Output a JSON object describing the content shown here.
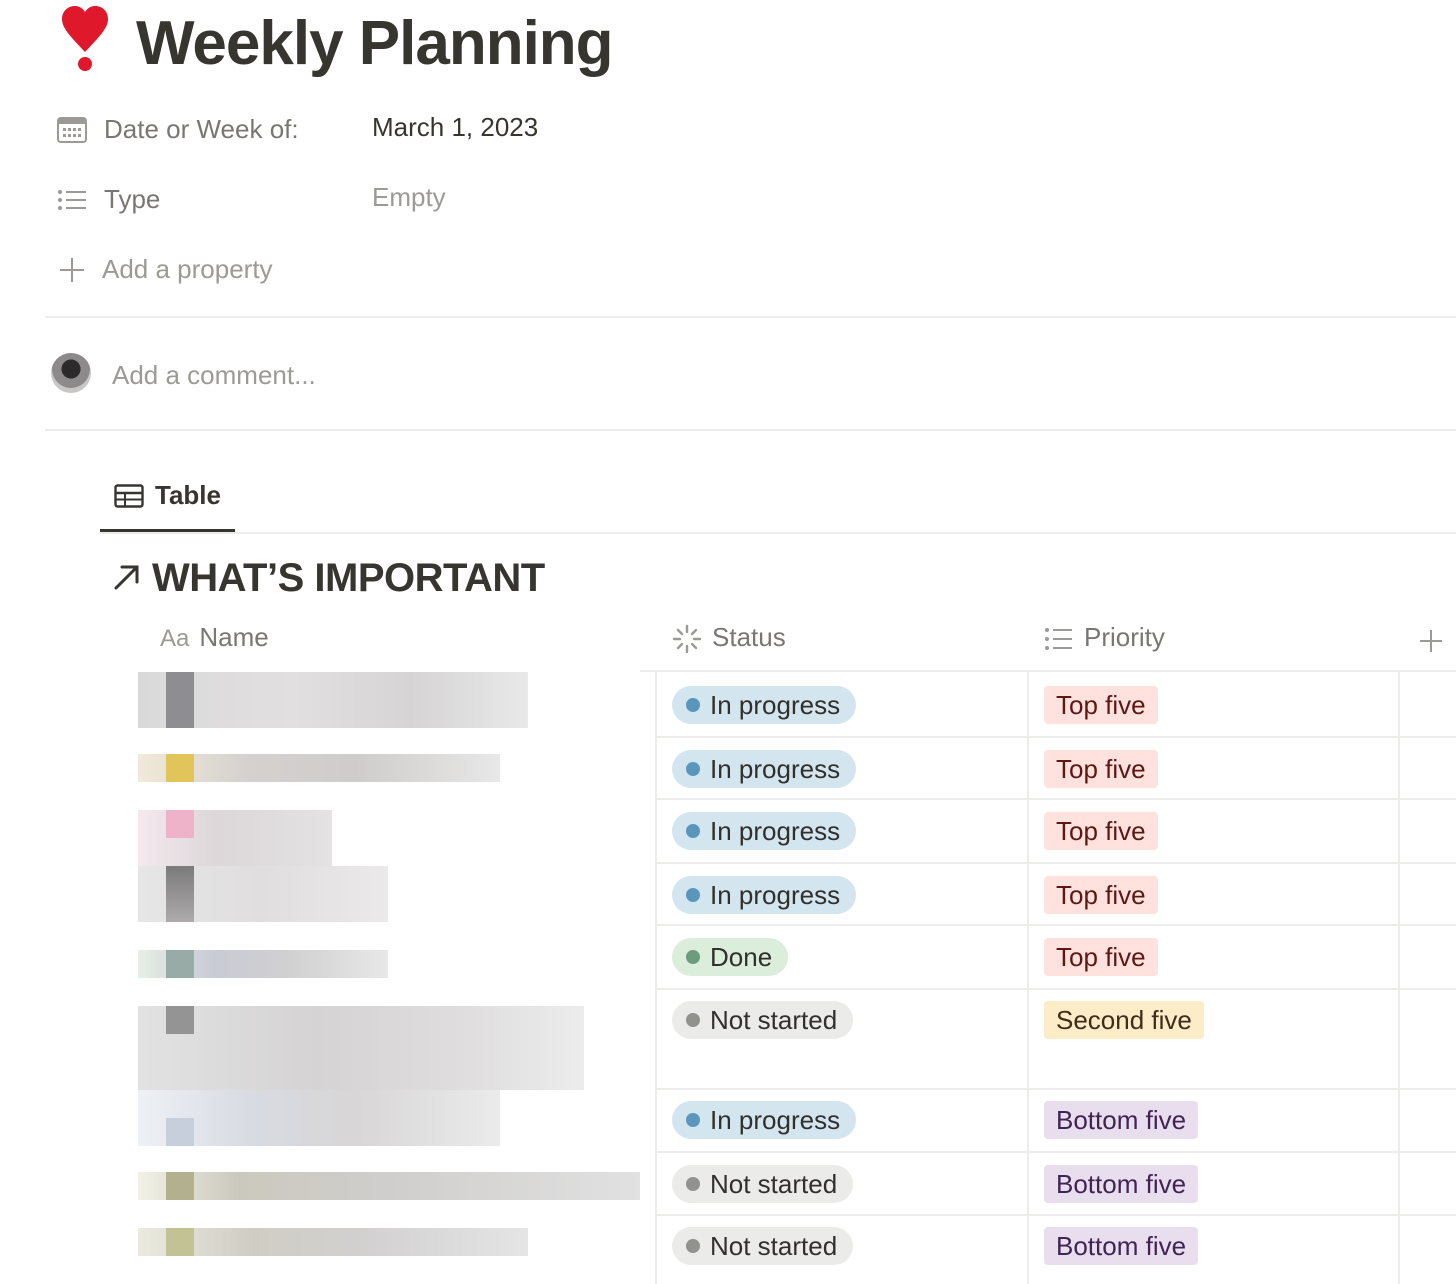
{
  "page": {
    "title_icon": "exclamation-icon",
    "title": "Weekly Planning"
  },
  "properties": [
    {
      "icon": "calendar-icon",
      "label": "Date or Week of:",
      "value": "March 1, 2023",
      "empty": false
    },
    {
      "icon": "list-icon",
      "label": "Type",
      "value": "Empty",
      "empty": true
    }
  ],
  "add_property_label": "Add a property",
  "comment_placeholder": "Add a comment...",
  "view_tab": {
    "icon": "table-icon",
    "label": "Table"
  },
  "database": {
    "title_icon": "arrow-up-right-icon",
    "title": "WHAT’S IMPORTANT",
    "columns": [
      {
        "icon": "Aa",
        "label": "Name"
      },
      {
        "icon": "status-icon",
        "label": "Status"
      },
      {
        "icon": "list-icon",
        "label": "Priority"
      }
    ],
    "add_column_icon": "plus-icon",
    "rows": [
      {
        "status": "In progress",
        "priority": "Top five"
      },
      {
        "status": "In progress",
        "priority": "Top five"
      },
      {
        "status": "In progress",
        "priority": "Top five"
      },
      {
        "status": "In progress",
        "priority": "Top five"
      },
      {
        "status": "Done",
        "priority": "Top five"
      },
      {
        "status": "Not started",
        "priority": "Second five"
      },
      {
        "status": "In progress",
        "priority": "Bottom five"
      },
      {
        "status": "Not started",
        "priority": "Bottom five"
      },
      {
        "status": "Not started",
        "priority": "Bottom five"
      }
    ]
  },
  "colors": {
    "in_progress_bg": "#d3e5ef",
    "in_progress_dot": "#5b97bd",
    "done_bg": "#dbeddb",
    "done_dot": "#6c9b7d",
    "not_started_bg": "#ebebea",
    "not_started_dot": "#91918e",
    "top_five_bg": "#ffe2dd",
    "second_five_bg": "#fdecc8",
    "bottom_five_bg": "#e8deee"
  }
}
